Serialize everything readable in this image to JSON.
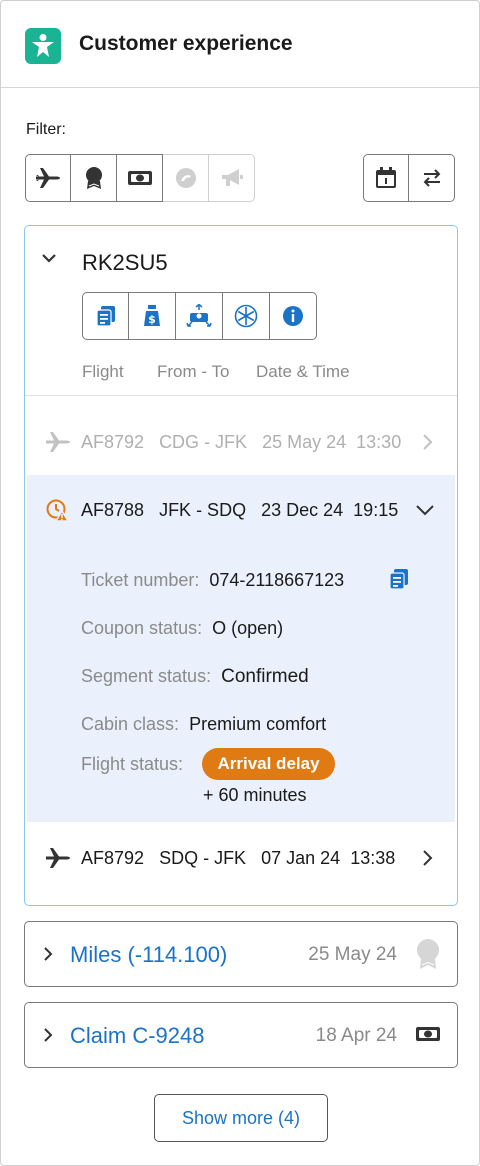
{
  "header": {
    "title": "Customer experience"
  },
  "filter": {
    "label": "Filter:",
    "buttons": [
      {
        "icon": "plane-icon",
        "enabled": true
      },
      {
        "icon": "award-icon",
        "enabled": true
      },
      {
        "icon": "banknote-icon",
        "enabled": true
      },
      {
        "icon": "chat-icon",
        "enabled": false
      },
      {
        "icon": "megaphone-icon",
        "enabled": false
      }
    ],
    "right_buttons": [
      {
        "icon": "calendar-icon"
      },
      {
        "icon": "swap-icon"
      }
    ]
  },
  "booking": {
    "pnr": "RK2SU5",
    "actions": [
      "document-icon",
      "moneybag-icon",
      "seat-icon",
      "snowflake-icon",
      "info-icon"
    ],
    "columns": {
      "flight": "Flight",
      "route": "From - To",
      "datetime": "Date & Time"
    },
    "segments": [
      {
        "flight": "AF8792",
        "route": "CDG - JFK",
        "date": "25 May 24",
        "time": "13:30",
        "state": "past"
      },
      {
        "flight": "AF8788",
        "route": "JFK - SDQ",
        "date": "23 Dec 24",
        "time": "19:15",
        "state": "expanded"
      },
      {
        "flight": "AF8792",
        "route": "SDQ - JFK",
        "date": "07 Jan 24",
        "time": "13:38",
        "state": "normal"
      }
    ],
    "details": {
      "ticket_label": "Ticket number:",
      "ticket_value": "074-2118667123",
      "coupon_label": "Coupon status:",
      "coupon_value": "O (open)",
      "segment_label": "Segment status:",
      "segment_value": "Confirmed",
      "cabin_label": "Cabin class:",
      "cabin_value": "Premium comfort",
      "flight_status_label": "Flight status:",
      "flight_status_badge": "Arrival delay",
      "delay_text": "+ 60 minutes"
    }
  },
  "cards": [
    {
      "title": "Miles (-114.100)",
      "date": "25 May 24",
      "icon": "award-icon"
    },
    {
      "title": "Claim C-9248",
      "date": "18 Apr 24",
      "icon": "banknote-icon"
    }
  ],
  "show_more": "Show more (4)",
  "colors": {
    "accent": "#1a73c7",
    "brand": "#1ab394",
    "warning": "#e07a12",
    "expanded_bg": "#eaf1fc"
  }
}
